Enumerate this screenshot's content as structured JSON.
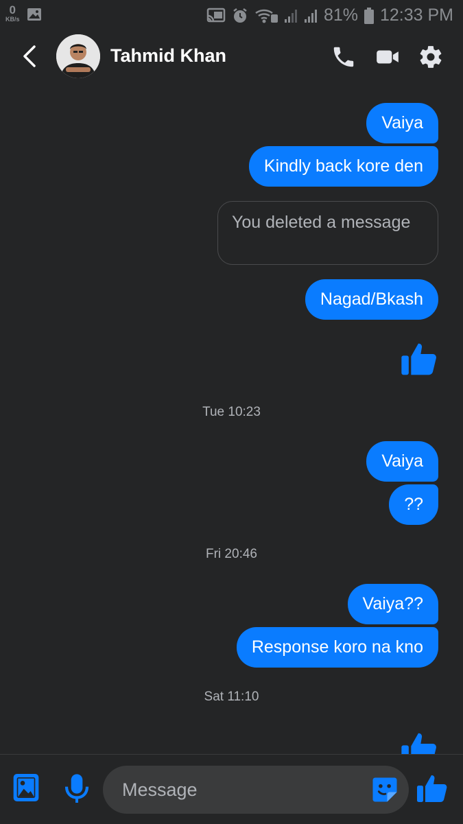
{
  "status_bar": {
    "speed_value": "0",
    "speed_unit": "KB/s",
    "battery": "81%",
    "time": "12:33 PM"
  },
  "header": {
    "contact_name": "Tahmid Khan",
    "icons": [
      "back-arrow-icon",
      "phone-icon",
      "video-camera-icon",
      "gear-icon"
    ]
  },
  "conversation": {
    "messages": [
      {
        "type": "sent",
        "text": "Vaiya"
      },
      {
        "type": "sent",
        "text": "Kindly back kore den"
      },
      {
        "type": "deleted",
        "text": "You deleted a message"
      },
      {
        "type": "sent",
        "text": "Nagad/Bkash"
      },
      {
        "type": "like"
      },
      {
        "type": "timestamp",
        "text": "Tue 10:23"
      },
      {
        "type": "sent",
        "text": "Vaiya"
      },
      {
        "type": "sent",
        "text": "??"
      },
      {
        "type": "timestamp",
        "text": "Fri 20:46"
      },
      {
        "type": "sent",
        "text": "Vaiya??"
      },
      {
        "type": "sent",
        "text": "Response koro na kno"
      },
      {
        "type": "timestamp",
        "text": "Sat 11:10"
      },
      {
        "type": "like"
      }
    ]
  },
  "composer": {
    "placeholder": "Message",
    "icons": [
      "gallery-icon",
      "microphone-icon",
      "sticker-icon",
      "thumbs-up-icon"
    ]
  },
  "colors": {
    "background": "#242526",
    "bubble": "#0a7cff",
    "accent": "#0a7cff",
    "timestamp": "#b0b3b8"
  }
}
